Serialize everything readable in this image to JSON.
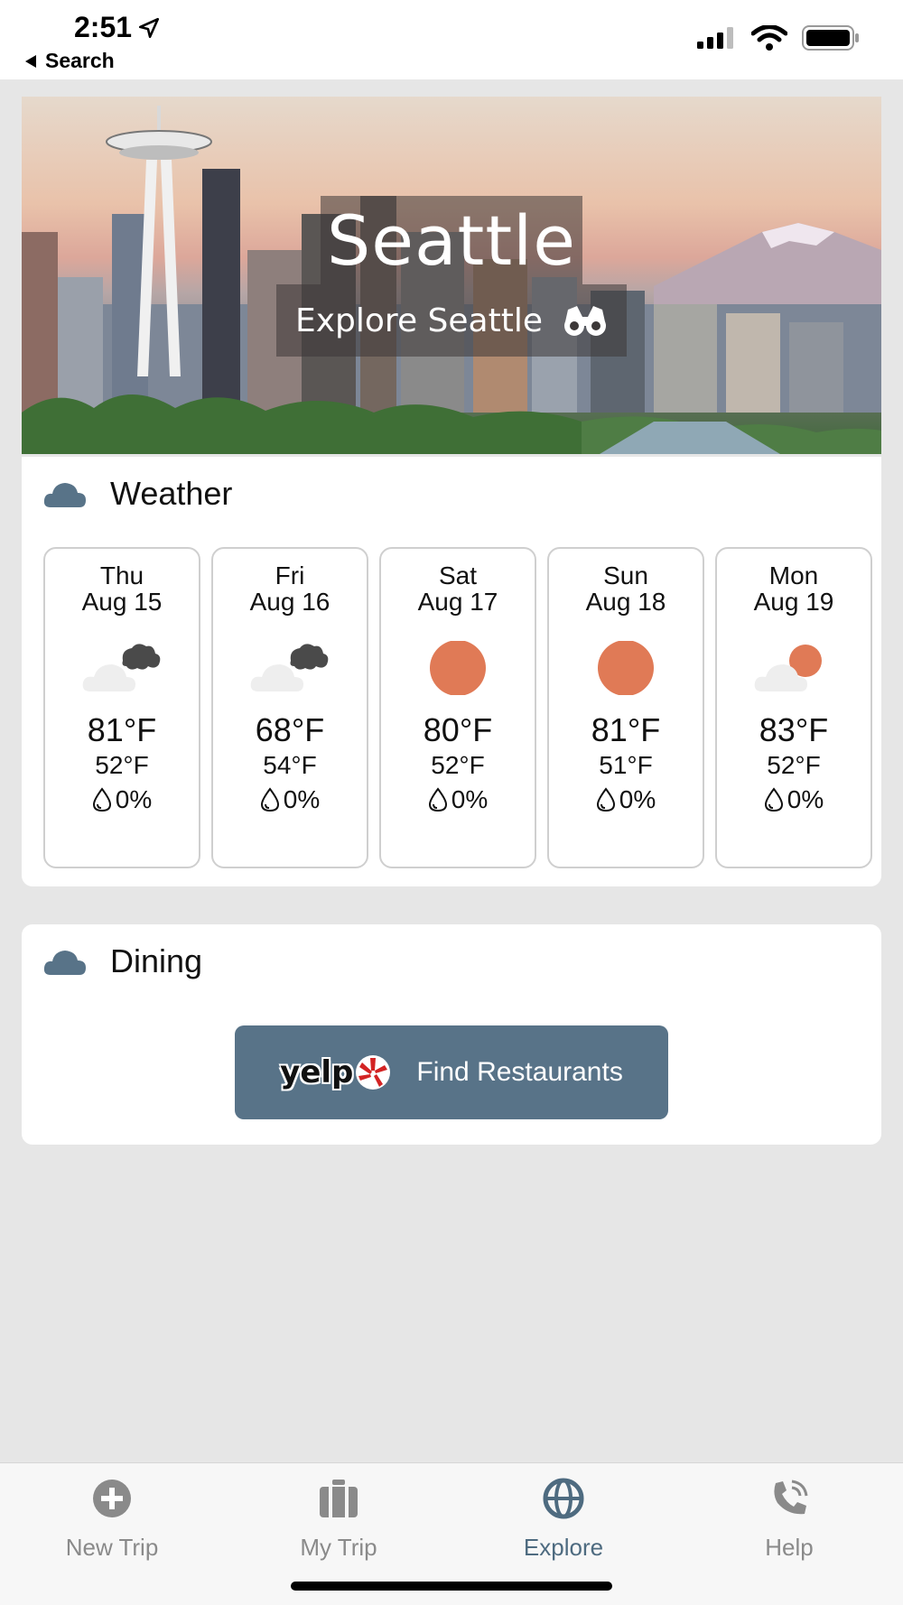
{
  "status_bar": {
    "time": "2:51",
    "back_label": "Search"
  },
  "hero": {
    "city": "Seattle",
    "subtitle": "Explore Seattle"
  },
  "weather": {
    "title": "Weather",
    "days": [
      {
        "day": "Thu",
        "date": "Aug 15",
        "icon": "partly-cloudy-night-icon",
        "high": "81°F",
        "low": "52°F",
        "rain": "0%"
      },
      {
        "day": "Fri",
        "date": "Aug 16",
        "icon": "partly-cloudy-night-icon",
        "high": "68°F",
        "low": "54°F",
        "rain": "0%"
      },
      {
        "day": "Sat",
        "date": "Aug 17",
        "icon": "sun-icon",
        "high": "80°F",
        "low": "52°F",
        "rain": "0%"
      },
      {
        "day": "Sun",
        "date": "Aug 18",
        "icon": "sun-icon",
        "high": "81°F",
        "low": "51°F",
        "rain": "0%"
      },
      {
        "day": "Mon",
        "date": "Aug 19",
        "icon": "partly-cloudy-day-icon",
        "high": "83°F",
        "low": "52°F",
        "rain": "0%"
      }
    ]
  },
  "dining": {
    "title": "Dining",
    "yelp_word": "yelp",
    "button_label": "Find Restaurants"
  },
  "tabs": [
    {
      "label": "New Trip",
      "icon": "plus-circle-icon",
      "active": false
    },
    {
      "label": "My Trip",
      "icon": "luggage-icon",
      "active": false
    },
    {
      "label": "Explore",
      "icon": "globe-icon",
      "active": true
    },
    {
      "label": "Help",
      "icon": "phone-icon",
      "active": false
    }
  ],
  "colors": {
    "accent": "#587388",
    "active_tab": "#4e6b80",
    "sun": "#e07a56",
    "background": "#e6e6e6"
  }
}
